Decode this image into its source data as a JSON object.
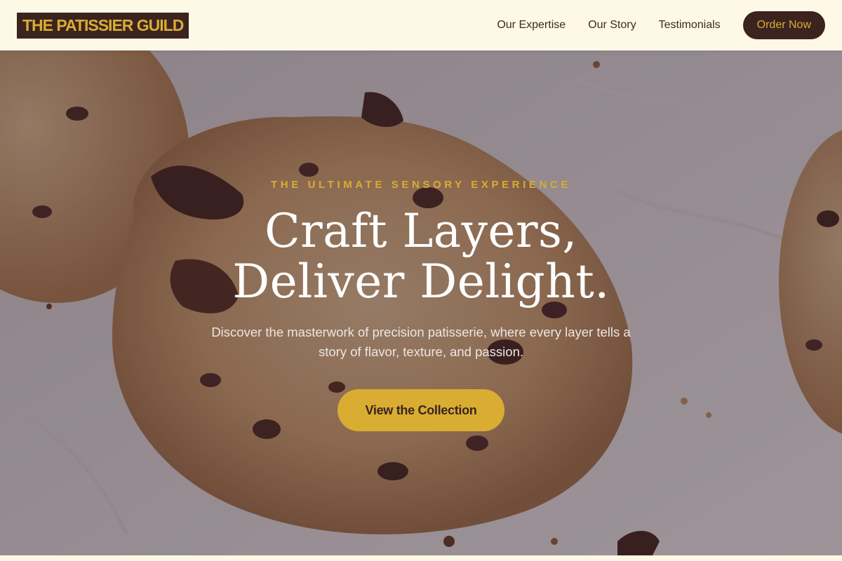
{
  "header": {
    "logo": "THE PATISSIER GUILD",
    "nav": [
      {
        "label": "Our Expertise"
      },
      {
        "label": "Our Story"
      },
      {
        "label": "Testimonials"
      }
    ],
    "order_label": "Order Now"
  },
  "hero": {
    "eyebrow": "THE ULTIMATE SENSORY EXPERIENCE",
    "headline_line1": "Craft Layers,",
    "headline_line2": "Deliver Delight.",
    "subtext": "Discover the masterwork of precision patisserie, where every layer tells a story of flavor, texture, and passion.",
    "cta_label": "View the Collection",
    "background": "chocolate-chip-cookies-photo"
  },
  "colors": {
    "brand_dark": "#3b2320",
    "brand_gold": "#d8ad32",
    "header_bg": "#fef9e6"
  }
}
